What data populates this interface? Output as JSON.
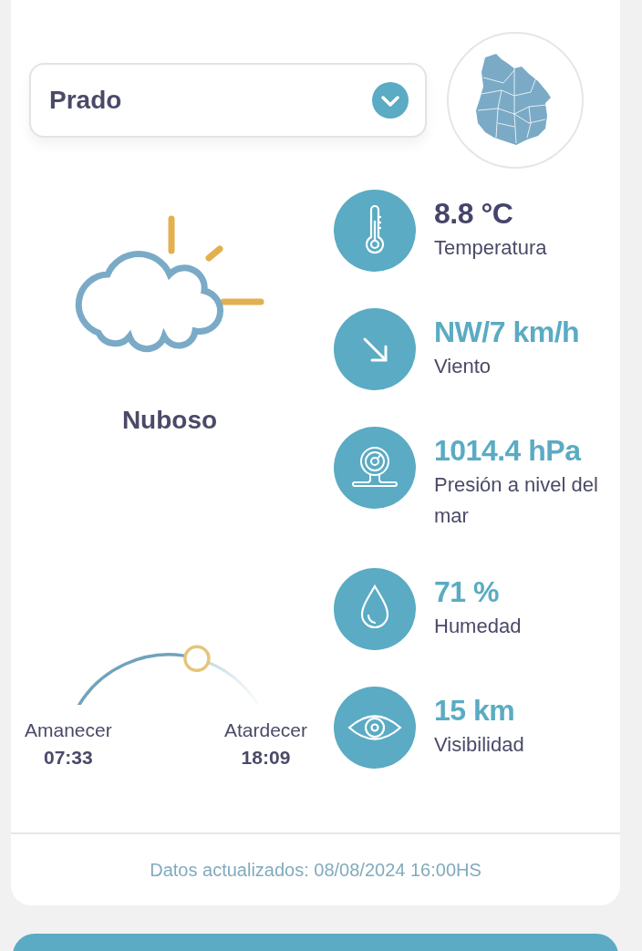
{
  "location_select": {
    "value": "Prado"
  },
  "condition": {
    "label": "Nuboso"
  },
  "sun": {
    "level": 0.62,
    "sunrise_label": "Amanecer",
    "sunrise_time": "07:33",
    "sunset_label": "Atardecer",
    "sunset_time": "18:09"
  },
  "metrics": [
    {
      "kind": "temperature",
      "value": "8.8 °C",
      "label": "Temperatura",
      "accent": false
    },
    {
      "kind": "wind",
      "value": "NW/7 km/h",
      "label": "Viento",
      "accent": true
    },
    {
      "kind": "pressure",
      "value": "1014.4 hPa",
      "label": "Presión a nivel del mar",
      "accent": true
    },
    {
      "kind": "humidity",
      "value": "71 %",
      "label": "Humedad",
      "accent": true
    },
    {
      "kind": "visibility",
      "value": "15 km",
      "label": "Visibilidad",
      "accent": true
    }
  ],
  "footer": {
    "text": "Datos actualizados: 08/08/2024 16:00HS"
  }
}
